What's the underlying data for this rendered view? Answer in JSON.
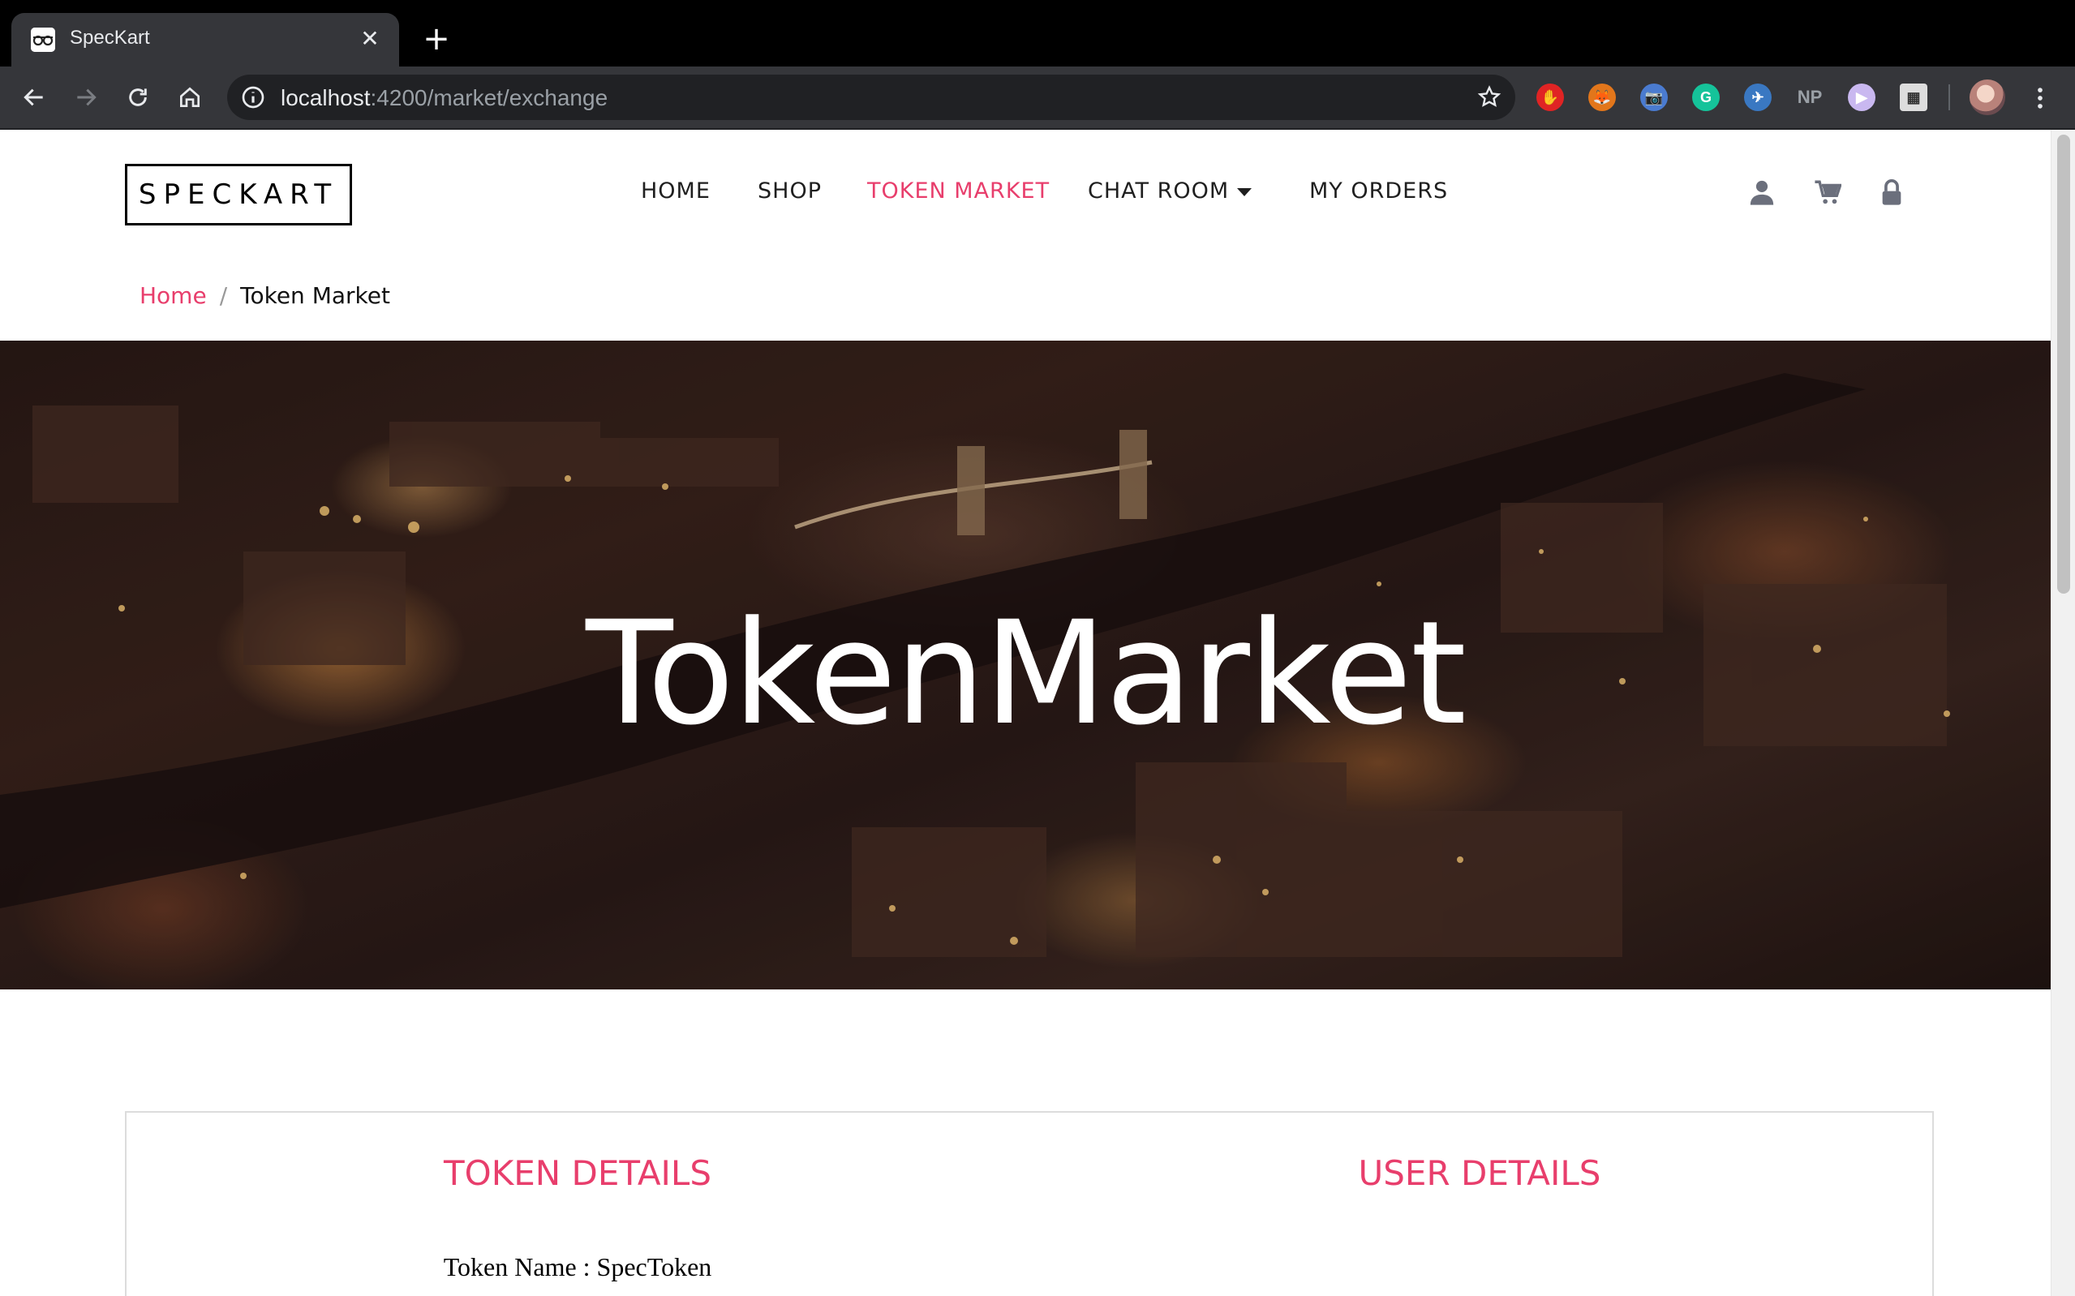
{
  "browser": {
    "tab_title": "SpecKart",
    "url_host": "localhost",
    "url_path": ":4200/market/exchange",
    "extensions": [
      {
        "name": "stop-extension-icon",
        "color": "#e02424",
        "label": "✋"
      },
      {
        "name": "metamask-fox-icon",
        "color": "#e2761b",
        "label": "🦊"
      },
      {
        "name": "camera-extension-icon",
        "color": "#4a7bd0",
        "label": "📷"
      },
      {
        "name": "grammarly-icon",
        "color": "#15c39a",
        "label": "G"
      },
      {
        "name": "plane-extension-icon",
        "color": "#3a78c2",
        "label": "✈"
      },
      {
        "name": "np-extension-icon",
        "color": "#35363a",
        "label": "NP"
      },
      {
        "name": "play-extension-icon",
        "color": "#c9b8f0",
        "label": "▶"
      },
      {
        "name": "chart-extension-icon",
        "color": "#dddddd",
        "label": "▦"
      }
    ]
  },
  "header": {
    "logo": "SPECKART",
    "nav": {
      "home": "HOME",
      "shop": "SHOP",
      "token_market": "TOKEN MARKET",
      "chat_room": "CHAT ROOM",
      "my_orders": "MY ORDERS"
    }
  },
  "breadcrumb": {
    "home": "Home",
    "separator": "/",
    "current": "Token Market"
  },
  "hero": {
    "title": "TokenMarket"
  },
  "panels": {
    "token_details": {
      "title": "TOKEN DETAILS",
      "token_name_line": "Token Name : SpecToken"
    },
    "user_details": {
      "title": "USER DETAILS"
    }
  },
  "colors": {
    "accent": "#e83e6c",
    "chrome_dark": "#35363a",
    "tabbar": "#000000"
  }
}
